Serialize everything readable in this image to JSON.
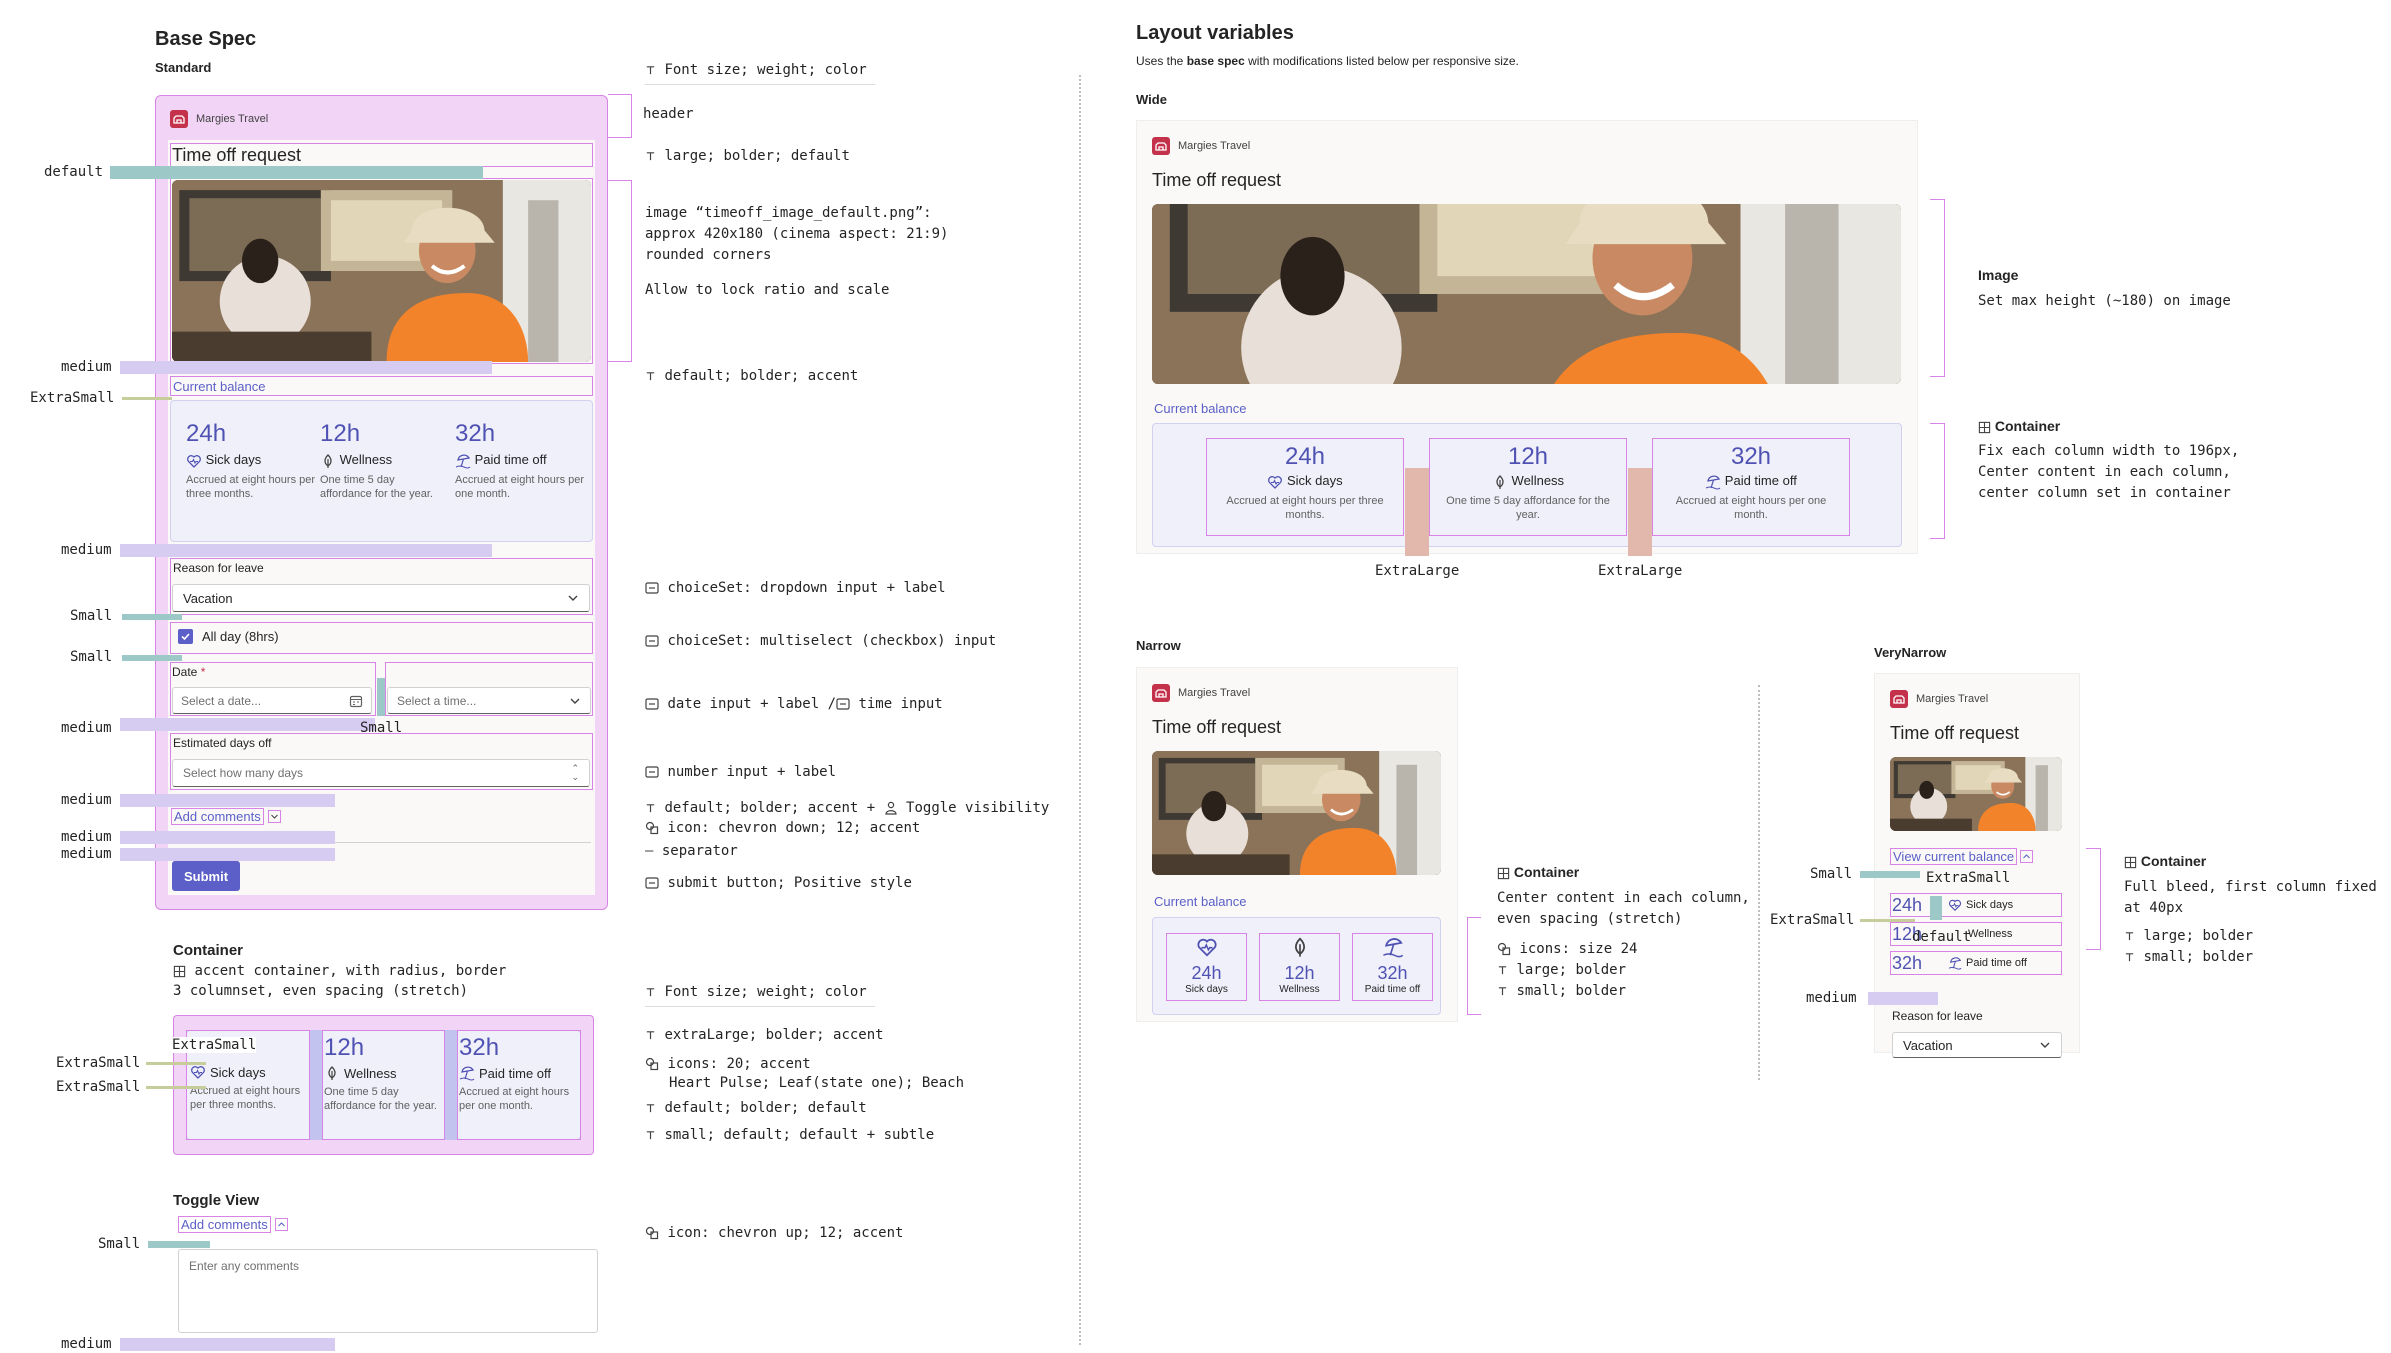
{
  "left": {
    "title": "Base Spec",
    "subtitle": "Standard",
    "card": {
      "app_name": "Margies Travel",
      "title": "Time off request",
      "balance_label": "Current balance",
      "stats": [
        {
          "value": "24h",
          "label": "Sick days",
          "desc": "Accrued at eight hours per three months.",
          "icon": "heart-pulse-icon"
        },
        {
          "value": "12h",
          "label": "Wellness",
          "desc": "One time 5 day affordance for the year.",
          "icon": "leaf-icon"
        },
        {
          "value": "32h",
          "label": "Paid time off",
          "desc": "Accrued at eight hours per one month.",
          "icon": "beach-icon"
        }
      ],
      "reason_label": "Reason for leave",
      "reason_value": "Vacation",
      "allday_label": "All day (8hrs)",
      "date_label": "Date",
      "required_mark": "*",
      "date_placeholder": "Select a date...",
      "time_placeholder": "Select a time...",
      "estimated_label": "Estimated days off",
      "estimated_placeholder": "Select how many days",
      "add_comments": "Add comments",
      "submit": "Submit"
    },
    "spacing_labels": {
      "default": "default",
      "medium": "medium",
      "extra_small": "ExtraSmall",
      "small": "Small"
    },
    "notes": {
      "font_header": "Font size; weight; color",
      "header": "header",
      "title_note": "large; bolder; default",
      "image_line1": "image “timeoff_image_default.png”:",
      "image_line2": "approx 420x180 (cinema aspect: 21:9)",
      "image_line3": "rounded corners",
      "image_line4": "Allow to lock ratio and scale",
      "balance_note": "default; bolder; accent",
      "choice_dropdown": "choiceSet: dropdown input + label",
      "choice_multi": "choiceSet: multiselect (checkbox) input",
      "date_time": "date input + label /",
      "time_input": "time input",
      "number_input": "number input + label",
      "toggle_a": "default; bolder; accent +",
      "toggle_b": "Toggle visibility",
      "chevron_down": "icon: chevron down; 12; accent",
      "separator": "separator",
      "submit_note": "submit button; Positive style"
    },
    "container": {
      "title": "Container",
      "line1": "accent container, with radius, border",
      "line2": "3 columnset, even spacing (stretch)",
      "notes": {
        "font": "Font size; weight; color",
        "big": "extraLarge; bolder; accent",
        "icons": "icons: 20; accent",
        "icons_list": "Heart Pulse; Leaf(state one); Beach",
        "label": "default; bolder; default",
        "desc": "small; default; default + subtle"
      }
    },
    "toggle": {
      "title": "Toggle View",
      "link": "Add comments",
      "placeholder": "Enter any comments",
      "note": "icon: chevron up; 12; accent"
    }
  },
  "right": {
    "title": "Layout variables",
    "subtitle_pre": "Uses the ",
    "subtitle_bold": "base spec",
    "subtitle_post": " with modifications listed below per responsive size.",
    "wide": {
      "label": "Wide",
      "image_note_title": "Image",
      "image_note": "Set max height (~180) on image",
      "container_title": "Container",
      "container_l1": "Fix each column width to 196px,",
      "container_l2": "Center content in each column,",
      "container_l3": "center column set in container",
      "gap_label": "ExtraLarge",
      "stats": [
        {
          "value": "24h",
          "label": "Sick days",
          "desc": "Accrued at eight hours per three months."
        },
        {
          "value": "12h",
          "label": "Wellness",
          "desc": "One time 5 day affordance for the year."
        },
        {
          "value": "32h",
          "label": "Paid time off",
          "desc": "Accrued at eight hours per one month."
        }
      ]
    },
    "narrow": {
      "label": "Narrow",
      "container_title": "Container",
      "l1": "Center content in each column,",
      "l2": "even spacing (stretch)",
      "l3": "icons: size 24",
      "l4": "large; bolder",
      "l5": "small; bolder",
      "stats": [
        {
          "value": "24h",
          "label": "Sick days"
        },
        {
          "value": "12h",
          "label": "Wellness"
        },
        {
          "value": "32h",
          "label": "Paid time off"
        }
      ]
    },
    "verynarrow": {
      "label": "VeryNarrow",
      "view_balance": "View current balance",
      "container_title": "Container",
      "l1": "Full bleed, first column fixed",
      "l2": "at 40px",
      "l3": "large; bolder",
      "l4": "small; bolder",
      "default_label": "default",
      "stats": [
        {
          "value": "24h",
          "label": "Sick days"
        },
        {
          "value": "12h",
          "label": "Wellness"
        },
        {
          "value": "32h",
          "label": "Paid time off"
        }
      ]
    }
  },
  "colors": {
    "accent": "#5b5fc7",
    "spec_magenta": "#d884e6",
    "logo_red": "#c4314b"
  }
}
